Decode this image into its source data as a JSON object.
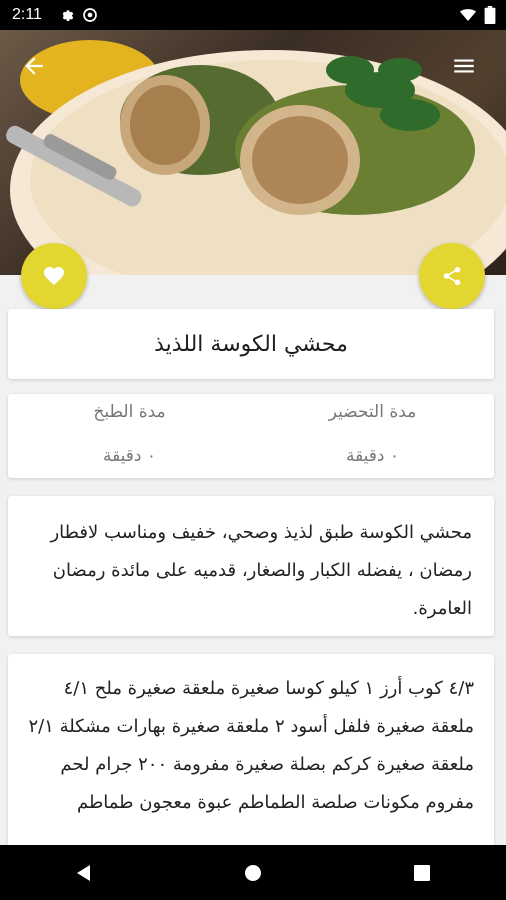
{
  "status_bar": {
    "time": "2:11"
  },
  "recipe": {
    "title": "محشي الكوسة اللذيذ",
    "prep_label": "مدة التحضير",
    "prep_value": "٠ دقيقة",
    "cook_label": "مدة الطبخ",
    "cook_value": "٠ دقيقة",
    "description": "محشي الكوسة طبق لذيذ وصحي، خفيف ومناسب لافطار رمضان ، يفضله الكبار والصغار، قدميه على مائدة رمضان العامرة.",
    "ingredients": "٤/٣ كوب أرز ١ كيلو كوسا صغيرة ملعقة صغيرة ملح ٤/١ ملعقة صغيرة فلفل أسود ٢ ملعقة صغيرة بهارات مشكلة ٢/١ ملعقة صغيرة كركم بصلة صغيرة مفرومة ٢٠٠ جرام لحم مفروم مكونات صلصة الطماطم عبوة معجون طماطم"
  },
  "colors": {
    "accent": "#e4d631",
    "background": "#f1f1f1"
  },
  "icons": {
    "back": "arrow-back-icon",
    "menu": "menu-icon",
    "favorite": "heart-icon",
    "share": "share-icon"
  }
}
